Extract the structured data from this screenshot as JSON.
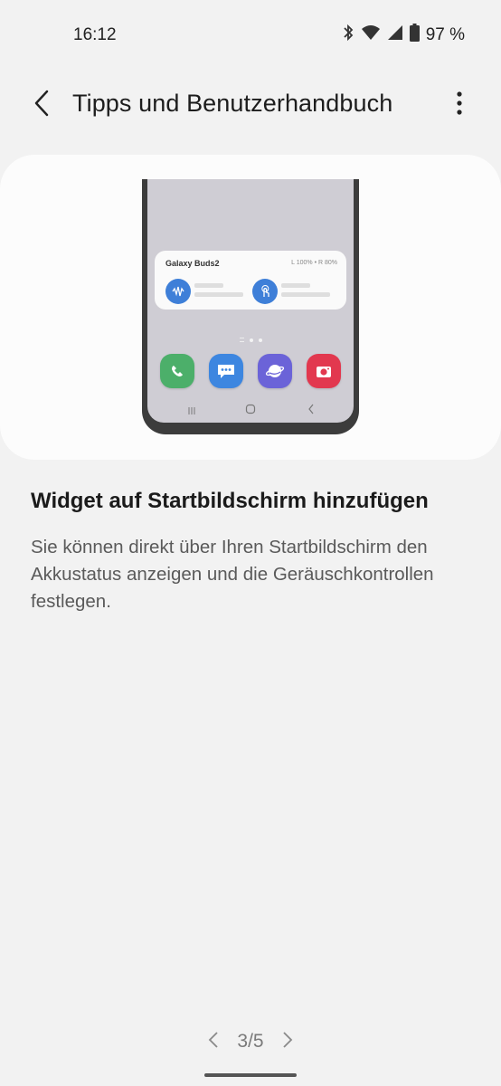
{
  "status_bar": {
    "time": "16:12",
    "battery_text": "97 %",
    "icons": [
      "bluetooth-icon",
      "wifi-icon",
      "signal-icon",
      "battery-icon"
    ]
  },
  "app_bar": {
    "title": "Tipps und Benutzerhandbuch",
    "back_icon": "back-arrow-icon",
    "more_icon": "more-vertical-icon"
  },
  "illustration": {
    "widget_name": "Galaxy Buds2",
    "widget_battery": "L 100% • R 80%",
    "dock_apps": [
      "phone-app-icon",
      "messages-app-icon",
      "internet-app-icon",
      "camera-app-icon"
    ],
    "colors": {
      "phone": "#4caf6a",
      "messages": "#3d86e0",
      "internet": "#6b63d8",
      "camera": "#e2384f",
      "widget_control": "#3e7fd8"
    }
  },
  "content": {
    "headline": "Widget auf Startbildschirm hinzufügen",
    "description": "Sie können direkt über Ihren Startbildschirm den Akkustatus anzeigen und die Geräuschkontrollen festlegen."
  },
  "pager": {
    "current": 3,
    "total": 5,
    "label": "3/5"
  }
}
